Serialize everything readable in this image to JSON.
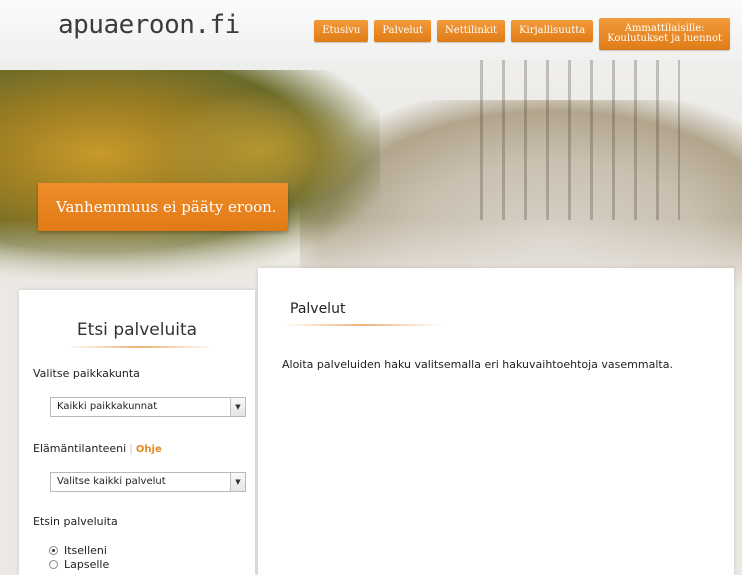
{
  "header": {
    "logo": "apuaeroon.fi",
    "nav": [
      {
        "label": "Etusivu"
      },
      {
        "label": "Palvelut"
      },
      {
        "label": "Nettilinkit"
      },
      {
        "label": "Kirjallisuutta"
      },
      {
        "line1": "Ammattilaisille:",
        "line2": "Koulutukset ja luennot"
      }
    ]
  },
  "hero": {
    "tagline": "Vanhemmuus ei pääty eroon."
  },
  "sidebar": {
    "title": "Etsi palveluita",
    "location_label": "Valitse paikkakunta",
    "location_value": "Kaikki paikkakunnat",
    "life_label": "Elämäntilanteeni",
    "help_link": "Ohje",
    "service_value": "Valitse kaikki palvelut",
    "seeking_label": "Etsin palveluita",
    "radios": [
      {
        "label": "Itselleni",
        "checked": true
      },
      {
        "label": "Lapselle",
        "checked": false
      }
    ]
  },
  "main": {
    "title": "Palvelut",
    "text": "Aloita palveluiden haku valitsemalla eri hakuvaihtoehtoja vasemmalta."
  },
  "colors": {
    "accent": "#e8841f",
    "page_bg": "#ece9e4"
  }
}
